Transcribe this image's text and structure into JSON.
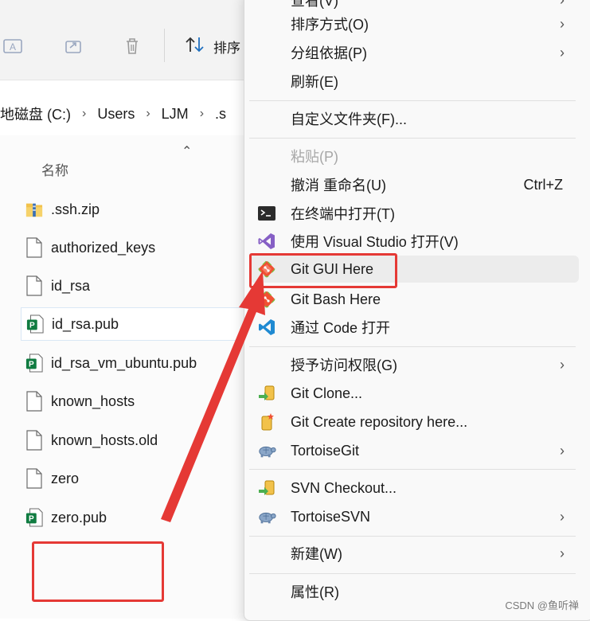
{
  "explorer": {
    "toolbar": {
      "sort_label": "排序"
    },
    "address_bar": {
      "crumbs": [
        "地磁盘 (C:)",
        "Users",
        "LJM",
        ".s"
      ]
    },
    "column_header": "名称",
    "files": [
      {
        "name": ".ssh.zip",
        "icon": "zip-folder-icon"
      },
      {
        "name": "authorized_keys",
        "icon": "file-icon"
      },
      {
        "name": "id_rsa",
        "icon": "file-icon"
      },
      {
        "name": "id_rsa.pub",
        "icon": "publisher-file-icon"
      },
      {
        "name": "id_rsa_vm_ubuntu.pub",
        "icon": "publisher-file-icon"
      },
      {
        "name": "known_hosts",
        "icon": "file-icon"
      },
      {
        "name": "known_hosts.old",
        "icon": "file-icon"
      },
      {
        "name": "zero",
        "icon": "file-icon"
      },
      {
        "name": "zero.pub",
        "icon": "publisher-file-icon"
      }
    ]
  },
  "context_menu": {
    "items": [
      {
        "label": "查看(V)",
        "icon": "",
        "submenu": true
      },
      {
        "label": "排序方式(O)",
        "icon": "",
        "submenu": true
      },
      {
        "label": "分组依据(P)",
        "icon": "",
        "submenu": true
      },
      {
        "label": "刷新(E)",
        "icon": ""
      },
      {
        "label": "自定义文件夹(F)...",
        "icon": ""
      },
      {
        "label": "粘贴(P)",
        "icon": "",
        "disabled": true
      },
      {
        "label": "撤消 重命名(U)",
        "shortcut": "Ctrl+Z",
        "icon": ""
      },
      {
        "label": "在终端中打开(T)",
        "icon": "terminal-icon"
      },
      {
        "label": "使用 Visual Studio 打开(V)",
        "icon": "visual-studio-icon"
      },
      {
        "label": "Git GUI Here",
        "icon": "git-icon",
        "highlighted": true
      },
      {
        "label": "Git Bash Here",
        "icon": "git-icon"
      },
      {
        "label": "通过 Code 打开",
        "icon": "vscode-icon"
      },
      {
        "label": "授予访问权限(G)",
        "icon": "",
        "submenu": true
      },
      {
        "label": "Git Clone...",
        "icon": "tortoisegit-clone-icon"
      },
      {
        "label": "Git Create repository here...",
        "icon": "tortoisegit-create-repo-icon"
      },
      {
        "label": "TortoiseGit",
        "icon": "tortoisegit-icon",
        "submenu": true
      },
      {
        "label": "SVN Checkout...",
        "icon": "svn-checkout-icon"
      },
      {
        "label": "TortoiseSVN",
        "icon": "tortoisesvn-icon",
        "submenu": true
      },
      {
        "label": "新建(W)",
        "icon": "",
        "submenu": true
      },
      {
        "label": "属性(R)",
        "icon": ""
      }
    ],
    "arrow_glyph": "›"
  },
  "colors": {
    "annotation_red": "#e53935",
    "git_orange": "#f05133",
    "vs_purple": "#865fc5",
    "vscode_blue": "#1f8ad2"
  },
  "watermark": "CSDN @鱼听禅"
}
